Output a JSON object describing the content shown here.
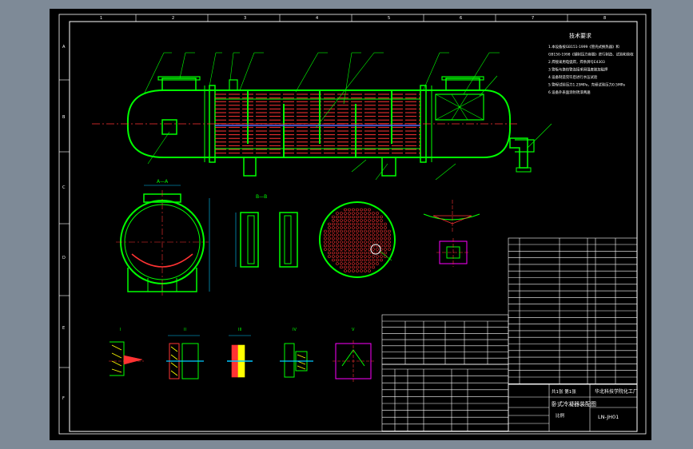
{
  "colors": {
    "background": "#7e8a97",
    "sheet": "#000000",
    "frame": "#ffffff",
    "vessel": "#00ff00",
    "tubes": "#ff3333",
    "dims": "#00c8ff",
    "hatch": "#ffff00",
    "accent": "#ff00ff",
    "blue_label": "#4d6bff"
  },
  "title_block": {
    "company": "华北科技学院化工厂",
    "drawing_name": "卧式冷凝器装配图",
    "drawing_number": "LN-JH01",
    "scale_label": "比例",
    "sheet_label": "共1张 第1张"
  },
  "tech_requirements": {
    "heading": "技术要求",
    "lines": [
      "1.本设备按GB151-1999《管壳式换热器》和",
      "GB150-1998《钢制压力容器》进行制造、试验和验收",
      "2.焊接采用电弧焊，焊条牌号E4303",
      "3.管板与换热管连接采用强度胀加贴焊",
      "4.设备制造完毕后进行水压试验",
      "5.管程试验压力1.25MPa，壳程试验压力0.5MPa",
      "6.设备外表面涂防锈漆两遍"
    ]
  },
  "section_labels": {
    "a": "A—A",
    "b": "B—B",
    "c": "C",
    "d": "I"
  },
  "detail_labels": [
    "I",
    "II",
    "III",
    "IV",
    "V"
  ],
  "frame_numbers": [
    "1",
    "2",
    "3",
    "4",
    "5",
    "6",
    "7",
    "8"
  ],
  "frame_letters": [
    "A",
    "B",
    "C",
    "D",
    "E",
    "F"
  ]
}
